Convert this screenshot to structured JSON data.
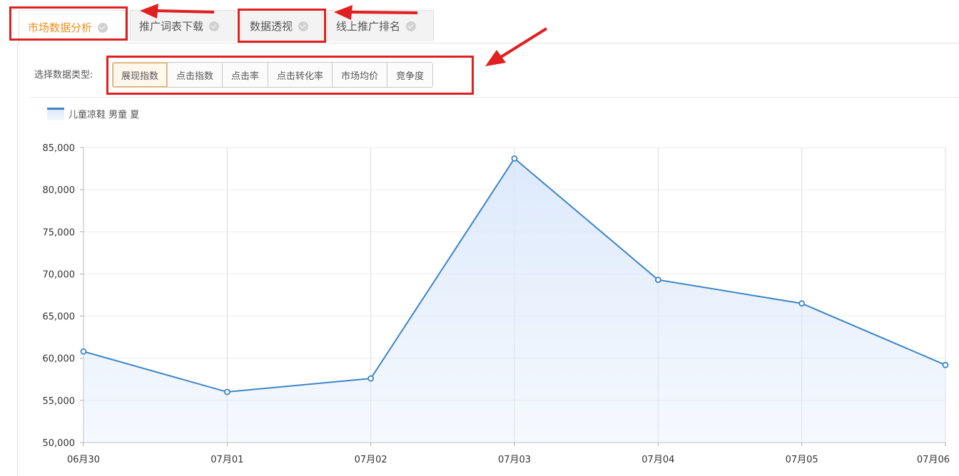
{
  "tabs": [
    {
      "label": "市场数据分析",
      "active": true
    },
    {
      "label": "推广词表下载",
      "active": false
    },
    {
      "label": "数据透视",
      "active": false
    },
    {
      "label": "线上推广排名",
      "active": false
    }
  ],
  "filter": {
    "label": "选择数据类型:",
    "options": [
      "展现指数",
      "点击指数",
      "点击率",
      "点击转化率",
      "市场均价",
      "竞争度"
    ],
    "selected_index": 0
  },
  "colors": {
    "accent": "#f08c1e",
    "highlight": "#e02020",
    "series_line": "#3d85c6",
    "series_fill": "#dbe8fb"
  },
  "chart_data": {
    "type": "area",
    "categories": [
      "06月30",
      "07月01",
      "07月02",
      "07月03",
      "07月04",
      "07月05",
      "07月06"
    ],
    "series": [
      {
        "name": "儿童凉鞋 男童 夏",
        "values": [
          60800,
          56000,
          57600,
          83700,
          69300,
          66500,
          59200
        ]
      }
    ],
    "ylim": [
      50000,
      85000
    ],
    "yticks": [
      50000,
      55000,
      60000,
      65000,
      70000,
      75000,
      80000,
      85000
    ],
    "ytick_labels": [
      "50,000",
      "55,000",
      "60,000",
      "65,000",
      "70,000",
      "75,000",
      "80,000",
      "85,000"
    ],
    "grid": true,
    "legend": "top-left"
  }
}
